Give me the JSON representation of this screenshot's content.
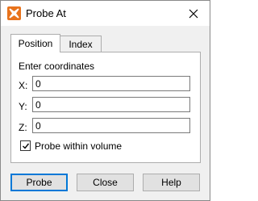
{
  "window": {
    "title": "Probe At",
    "icon": "probe-app-icon",
    "close_icon": "close-icon"
  },
  "tabs": [
    {
      "label": "Position",
      "active": true
    },
    {
      "label": "Index",
      "active": false
    }
  ],
  "position_panel": {
    "heading": "Enter coordinates",
    "fields": [
      {
        "label": "X:",
        "value": "0"
      },
      {
        "label": "Y:",
        "value": "0"
      },
      {
        "label": "Z:",
        "value": "0"
      }
    ],
    "checkbox": {
      "label": "Probe within volume",
      "checked": true
    }
  },
  "buttons": {
    "probe": "Probe",
    "close": "Close",
    "help": "Help"
  },
  "colors": {
    "focus_accent": "#0078d7",
    "dialog_background": "#f0f0f0",
    "icon_orange": "#e8731c"
  }
}
